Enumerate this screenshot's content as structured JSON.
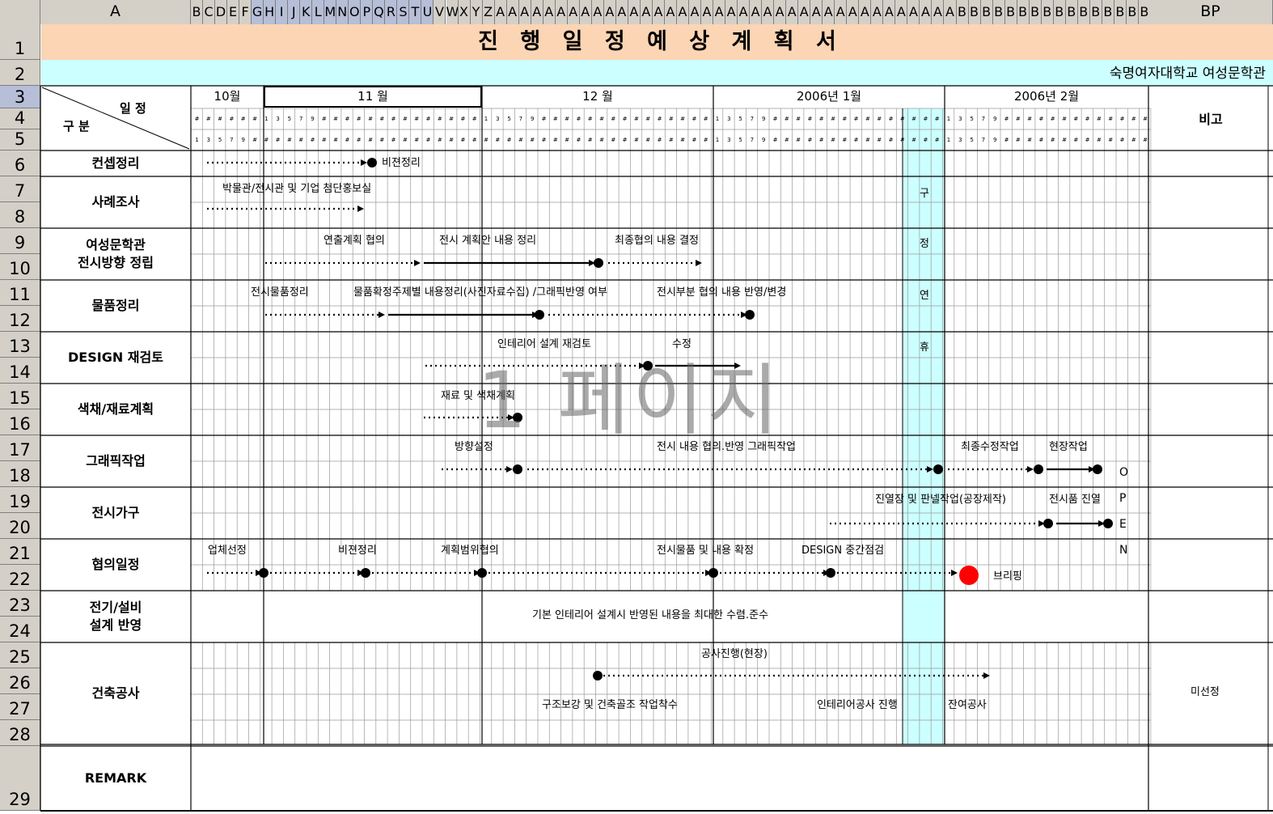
{
  "title": "진 행 일 정 예 상 계 획 서",
  "org": "숙명여자대학교 여성문학관",
  "watermark": "1 페이지",
  "header_corner": {
    "top": "일 정",
    "bottom": "구 분"
  },
  "bigo": "비고",
  "remark": "REMARK",
  "colA": "A",
  "colBP": "BP",
  "col_letters": [
    "B",
    "C",
    "D",
    "E",
    "F",
    "G",
    "H",
    "I",
    "J",
    "K",
    "L",
    "M",
    "N",
    "O",
    "P",
    "Q",
    "R",
    "S",
    "T",
    "U",
    "V",
    "W",
    "X",
    "Y",
    "Z",
    "A",
    "A",
    "A",
    "A",
    "A",
    "A",
    "A",
    "A",
    "A",
    "A",
    "A",
    "A",
    "A",
    "A",
    "A",
    "A",
    "A",
    "A",
    "A",
    "A",
    "A",
    "A",
    "A",
    "A",
    "A",
    "A",
    "A",
    "A",
    "A",
    "A",
    "A",
    "A",
    "A",
    "A",
    "A",
    "A",
    "A",
    "A",
    "B",
    "B",
    "B",
    "B",
    "B",
    "B",
    "B",
    "B",
    "B",
    "B",
    "B",
    "B",
    "B",
    "B",
    "B",
    "B"
  ],
  "months": [
    "10월",
    "11 월",
    "12 월",
    "2006년 1월",
    "2006년 2월"
  ],
  "day_markers": {
    "odd": [
      "1",
      "3",
      "5",
      "7",
      "9"
    ],
    "hash": "#"
  },
  "rows": [
    "1",
    "2",
    "3",
    "4",
    "5",
    "6",
    "7",
    "8",
    "9",
    "10",
    "11",
    "12",
    "13",
    "14",
    "15",
    "16",
    "17",
    "18",
    "19",
    "20",
    "21",
    "22",
    "23",
    "24",
    "25",
    "26",
    "27",
    "28",
    "29"
  ],
  "categories": [
    "컨셉정리",
    "사례조사",
    "여성문학관\n전시방향 정립",
    "물품정리",
    "DESIGN 재검토",
    "색채/재료계획",
    "그래픽작업",
    "전시가구",
    "협의일정",
    "전기/설비\n설계 반영",
    "건축공사"
  ],
  "holiday": [
    "구",
    "정",
    "연",
    "휴"
  ],
  "open": [
    "O",
    "P",
    "E",
    "N"
  ],
  "annotations": {
    "a1": "비젼정리",
    "a2": "박물관/전시관 및 기업 첨단홍보실",
    "a3": "연출계획 협의",
    "a4": "전시 계획안 내용 정리",
    "a5": "최종협의 내용 결정",
    "a6": "전시물품정리",
    "a7": "물품확정주제별 내용정리(사진자료수집) /그래픽반영 여부",
    "a8": "전시부분 협의 내용 반영/변경",
    "a9": "인테리어 설계 재검토",
    "a10": "수정",
    "a11": "재료 및 색채계획",
    "a12": "방향설정",
    "a13": "전시 내용 협의.반영 그래픽작업",
    "a14": "최종수정작업",
    "a15": "현장작업",
    "a16": "진열장 및 판넬작업(공장제작)",
    "a17": "전시품 진열",
    "a18": "업체선정",
    "a19": "비젼정리",
    "a20": "계획범위협의",
    "a21": "전시물품 및 내용 확정",
    "a22": "DESIGN 중간점검",
    "a23": "브리핑",
    "a24": "기본 인테리어 설계시 반영된 내용을 최대한 수렴.준수",
    "a25": "공사진행(현장)",
    "a26": "구조보강 및 건축골조 작업착수",
    "a27": "인테리어공사 진행",
    "a28": "잔여공사",
    "a29": "미선정"
  },
  "colors": {
    "title_bg": "#fcd5b4",
    "org_bg": "#ccffff",
    "holiday_bg": "#ccffff",
    "header_bg": "#d4d0c8",
    "briefing": "#ff0000"
  }
}
